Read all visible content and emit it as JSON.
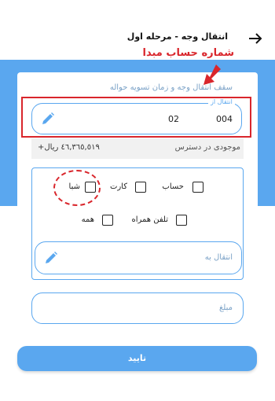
{
  "header": {
    "title": "انتقال وجه - مرحله اول"
  },
  "annotation": {
    "text": "شماره حساب مبدا"
  },
  "form": {
    "limit_text": "سقف انتقال وجه و زمان تسویه حواله",
    "source": {
      "legend": "انتقال از",
      "part1": "004",
      "part2": "02"
    },
    "balance": {
      "label": "موجودی در دسترس",
      "value": "+٤٦,٣٦٥,٥١٩ ریال"
    },
    "destination_types": [
      {
        "label": "حساب",
        "checked": false
      },
      {
        "label": "کارت",
        "checked": false
      },
      {
        "label": "شبا",
        "checked": false
      },
      {
        "label": "تلفن همراه",
        "checked": false
      },
      {
        "label": "همه",
        "checked": false
      }
    ],
    "destination": {
      "placeholder": "انتقال به"
    },
    "amount": {
      "placeholder": "مبلغ"
    }
  },
  "confirm_button": {
    "label": "تایید"
  },
  "colors": {
    "accent": "#5aa7ef",
    "annotation": "#d9262c"
  },
  "icons": {
    "back": "arrow-right-icon",
    "edit": "pencil-icon"
  }
}
